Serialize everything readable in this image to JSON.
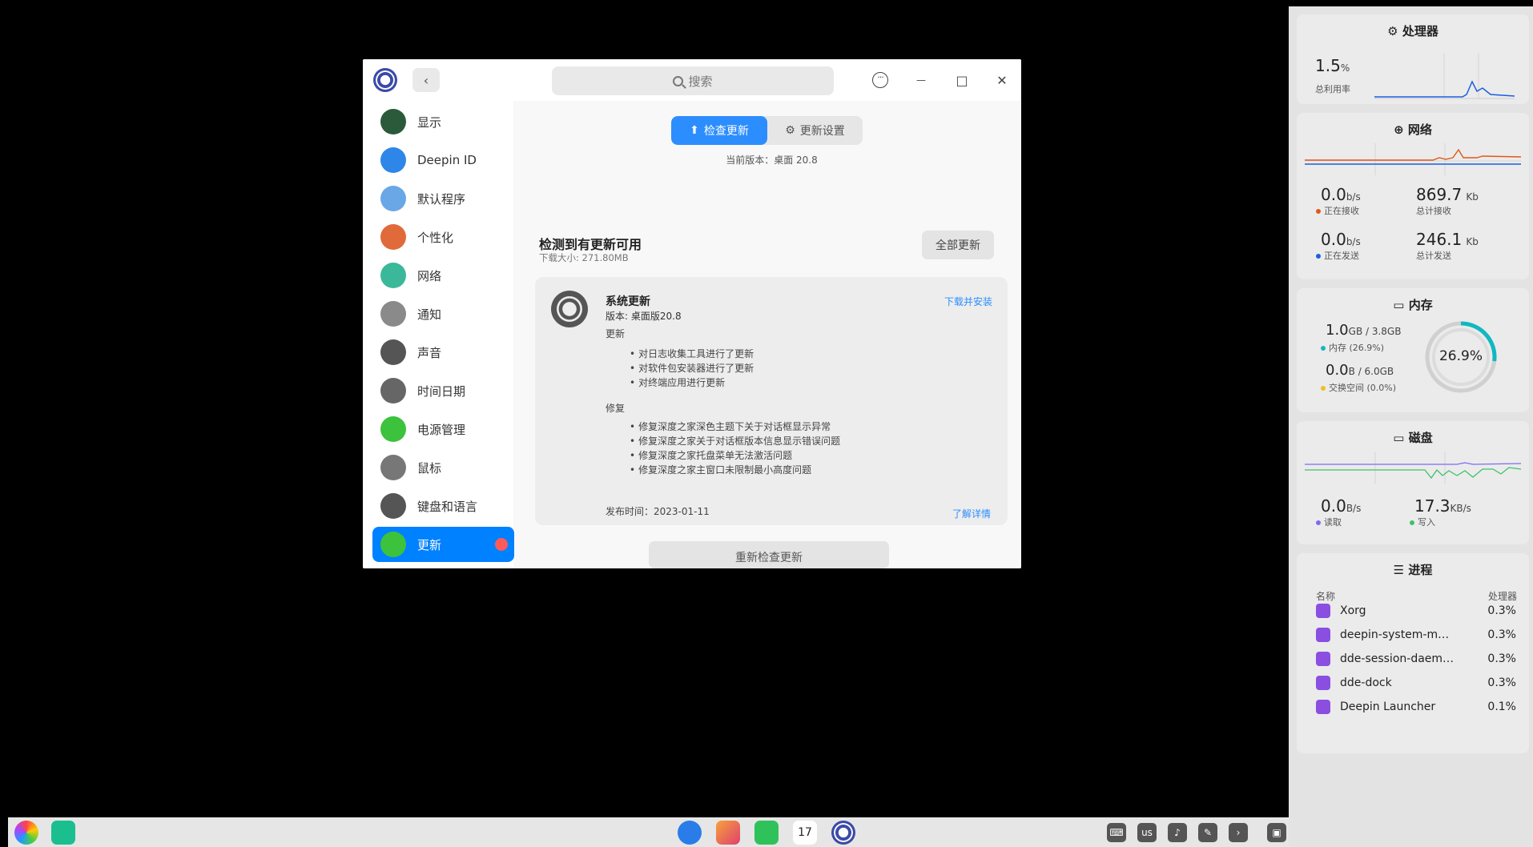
{
  "window": {
    "search_placeholder": "搜索",
    "back_glyph": "‹",
    "menu_glyph": "···",
    "minimize_glyph": "—",
    "maximize_glyph": "□",
    "close_glyph": "✕"
  },
  "sidebar": {
    "items": [
      {
        "label": "显示",
        "icon": "display-icon",
        "color": "#2a5a3a"
      },
      {
        "label": "Deepin ID",
        "icon": "cloud-icon",
        "color": "#2e86e8"
      },
      {
        "label": "默认程序",
        "icon": "default-apps-icon",
        "color": "#6aa7e6"
      },
      {
        "label": "个性化",
        "icon": "palette-icon",
        "color": "#e06a3a"
      },
      {
        "label": "网络",
        "icon": "network-icon",
        "color": "#3bb89a"
      },
      {
        "label": "通知",
        "icon": "bell-icon",
        "color": "#8a8a8a"
      },
      {
        "label": "声音",
        "icon": "speaker-icon",
        "color": "#555555"
      },
      {
        "label": "时间日期",
        "icon": "clock-icon",
        "color": "#666666"
      },
      {
        "label": "电源管理",
        "icon": "battery-icon",
        "color": "#3cc23c"
      },
      {
        "label": "鼠标",
        "icon": "mouse-icon",
        "color": "#777777"
      },
      {
        "label": "键盘和语言",
        "icon": "keyboard-icon",
        "color": "#555555"
      },
      {
        "label": "更新",
        "icon": "update-icon",
        "color": "#3cc23c",
        "active": true
      }
    ]
  },
  "update": {
    "tab_check": "检查更新",
    "tab_settings": "更新设置",
    "current_version": "当前版本：桌面 20.8",
    "found_title": "检测到有更新可用",
    "download_size": "下载大小: 271.80MB",
    "update_all": "全部更新",
    "card": {
      "title": "系统更新",
      "version": "版本: 桌面版20.8",
      "download_install": "下载并安装",
      "section_update": "更新",
      "updates": [
        "对日志收集工具进行了更新",
        "对软件包安装器进行了更新",
        "对终端应用进行更新"
      ],
      "section_fix": "修复",
      "fixes": [
        "修复深度之家深色主题下关于对话框显示异常",
        "修复深度之家关于对话框版本信息显示错误问题",
        "修复深度之家托盘菜单无法激活问题",
        "修复深度之家主窗口未限制最小高度问题"
      ],
      "release_date": "发布时间：2023-01-11",
      "learn_more": "了解详情"
    },
    "recheck": "重新检查更新"
  },
  "monitor": {
    "cpu": {
      "title": "处理器",
      "value": "1.5",
      "unit": "%",
      "label": "总利用率"
    },
    "network": {
      "title": "网络",
      "recv_rate": "0.0",
      "recv_rate_unit": "b/s",
      "recv_label": "正在接收",
      "recv_total": "869.7",
      "recv_total_unit": "Kb",
      "recv_total_label": "总计接收",
      "send_rate": "0.0",
      "send_rate_unit": "b/s",
      "send_label": "正在发送",
      "send_total": "246.1",
      "send_total_unit": "Kb",
      "send_total_label": "总计发送",
      "recv_color": "#e0581a",
      "send_color": "#1a5ee0"
    },
    "memory": {
      "title": "内存",
      "mem_used": "1.0",
      "mem_text": "GB / 3.8GB",
      "mem_label": "内存 (26.9%)",
      "swap_used": "0.0",
      "swap_text": "B / 6.0GB",
      "swap_label": "交换空间 (0.0%)",
      "percent": "26.9%",
      "percent_value": 26.9
    },
    "disk": {
      "title": "磁盘",
      "read": "0.0",
      "read_unit": "B/s",
      "read_label": "读取",
      "write": "17.3",
      "write_unit": "KB/s",
      "write_label": "写入"
    },
    "process": {
      "title": "进程",
      "col_name": "名称",
      "col_cpu": "处理器",
      "rows": [
        {
          "name": "Xorg",
          "cpu": "0.3%"
        },
        {
          "name": "deepin-system-m…",
          "cpu": "0.3%"
        },
        {
          "name": "dde-session-daem…",
          "cpu": "0.3%"
        },
        {
          "name": "dde-dock",
          "cpu": "0.3%"
        },
        {
          "name": "Deepin Launcher",
          "cpu": "0.1%"
        }
      ]
    }
  },
  "dock": {
    "calendar_day": "17",
    "keyboard_layout": "us"
  }
}
